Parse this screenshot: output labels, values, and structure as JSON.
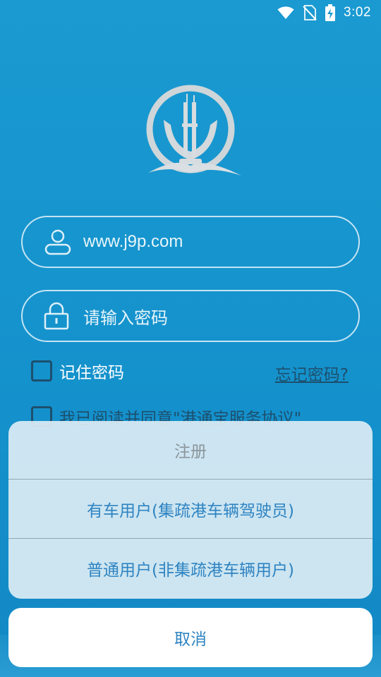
{
  "status_bar": {
    "time": "3:02",
    "icons": [
      "wifi-icon",
      "no-sim-icon",
      "battery-charging-icon"
    ]
  },
  "logo": {
    "icon": "port-anchor-logo-icon"
  },
  "login": {
    "username_value": "www.j9p.com",
    "password_placeholder": "请输入密码",
    "remember_label": "记住密码",
    "forgot_label": "忘记密码?",
    "agreement_label": "我已阅读并同意\"港通宝服务协议\"",
    "remember_checked": false,
    "agreement_checked": false
  },
  "action_sheet": {
    "title": "注册",
    "options": [
      "有车用户(集疏港车辆驾驶员)",
      "普通用户(非集疏港车辆用户)"
    ],
    "cancel_label": "取消"
  },
  "colors": {
    "background": "#1596cf",
    "sheet_background": "#dcecf4",
    "option_text": "#2f84c2",
    "title_text": "#8b959b",
    "dark_link": "#1d4f6d"
  }
}
